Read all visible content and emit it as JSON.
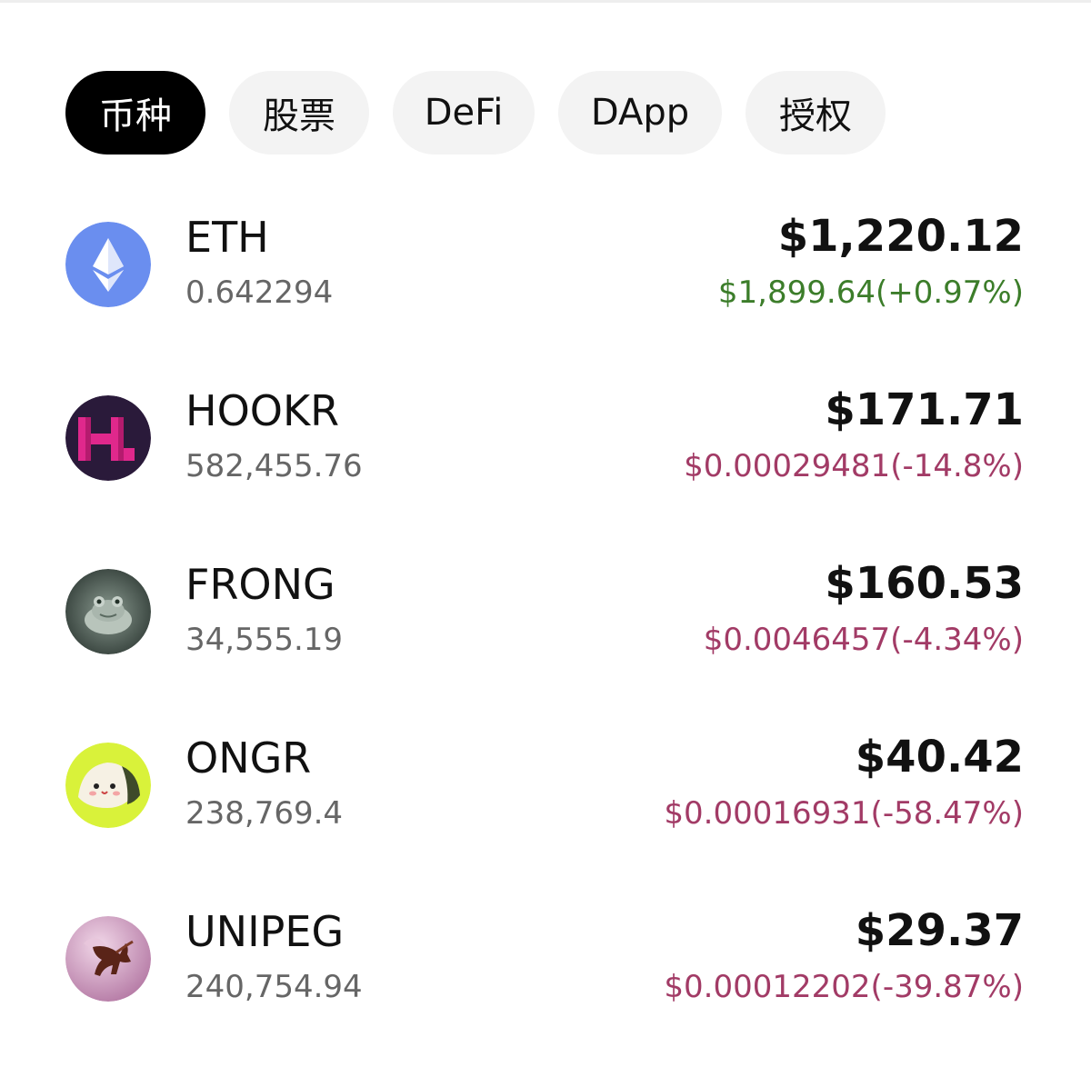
{
  "tabs": [
    {
      "label": "币种",
      "active": true
    },
    {
      "label": "股票",
      "active": false
    },
    {
      "label": "DeFi",
      "active": false
    },
    {
      "label": "DApp",
      "active": false
    },
    {
      "label": "授权",
      "active": false
    }
  ],
  "assets": [
    {
      "symbol": "ETH",
      "balance": "0.642294",
      "value": "$1,220.12",
      "price_change": "$1,899.64(+0.97%)",
      "trend": "up",
      "icon": "eth-icon"
    },
    {
      "symbol": "HOOKR",
      "balance": "582,455.76",
      "value": "$171.71",
      "price_change": "$0.00029481(-14.8%)",
      "trend": "down",
      "icon": "hookr-icon"
    },
    {
      "symbol": "FRONG",
      "balance": "34,555.19",
      "value": "$160.53",
      "price_change": "$0.0046457(-4.34%)",
      "trend": "down",
      "icon": "frog-icon"
    },
    {
      "symbol": "ONGR",
      "balance": "238,769.4",
      "value": "$40.42",
      "price_change": "$0.00016931(-58.47%)",
      "trend": "down",
      "icon": "onigiri-icon"
    },
    {
      "symbol": "UNIPEG",
      "balance": "240,754.94",
      "value": "$29.37",
      "price_change": "$0.00012202(-39.87%)",
      "trend": "down",
      "icon": "pegasus-icon"
    }
  ],
  "colors": {
    "positive": "#3c7d2a",
    "negative": "#a23b66",
    "active_tab_bg": "#000000",
    "tab_bg": "#f3f3f3"
  }
}
